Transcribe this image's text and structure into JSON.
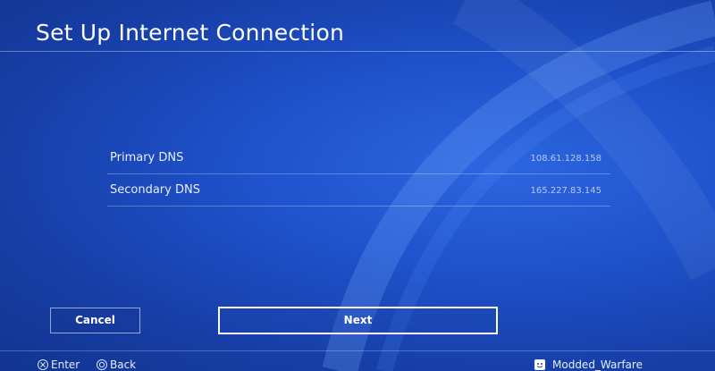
{
  "header": {
    "title": "Set Up Internet Connection"
  },
  "dns": {
    "rows": [
      {
        "label": "Primary DNS",
        "value": "108.61.128.158"
      },
      {
        "label": "Secondary DNS",
        "value": "165.227.83.145"
      }
    ]
  },
  "buttons": {
    "cancel_label": "Cancel",
    "next_label": "Next"
  },
  "footer": {
    "enter_label": "Enter",
    "back_label": "Back",
    "enter_icon": "cross-button-icon",
    "back_icon": "circle-button-icon",
    "username": "Modded_Warfare"
  },
  "colors": {
    "background": "#1a45b8",
    "text": "#ffffff"
  }
}
